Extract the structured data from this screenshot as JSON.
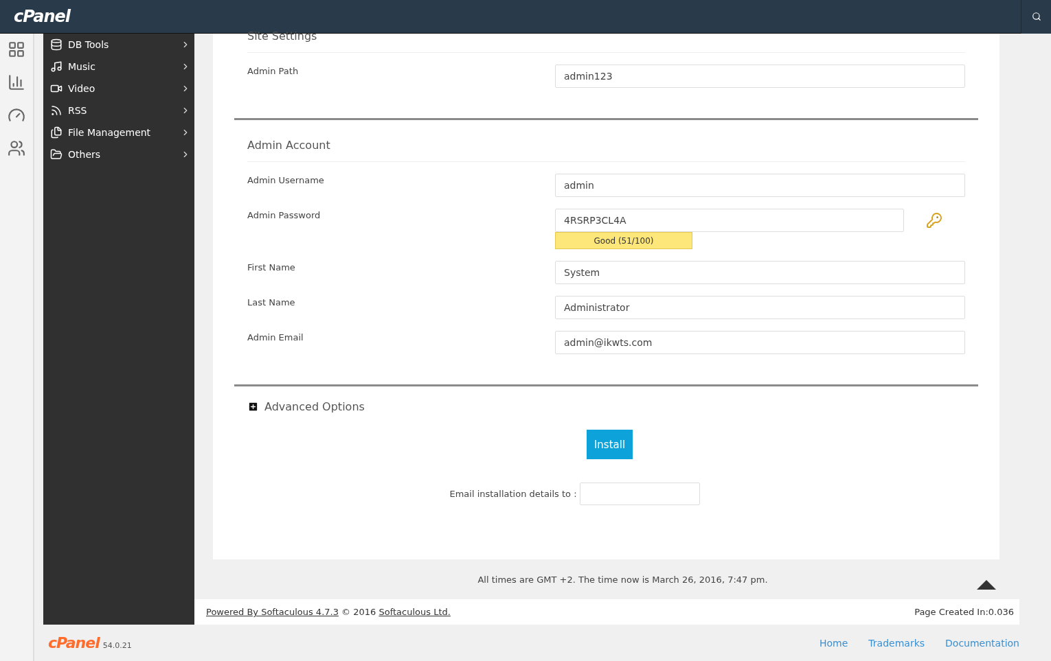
{
  "header": {
    "logo": "cPanel"
  },
  "rail": [
    {
      "kind": "grid"
    },
    {
      "kind": "stats"
    },
    {
      "kind": "gauge"
    },
    {
      "kind": "users"
    }
  ],
  "sidebar": {
    "items": [
      {
        "label": "DB Tools",
        "kind": "database"
      },
      {
        "label": "Music",
        "kind": "music"
      },
      {
        "label": "Video",
        "kind": "video"
      },
      {
        "label": "RSS",
        "kind": "rss"
      },
      {
        "label": "File Management",
        "kind": "files"
      },
      {
        "label": "Others",
        "kind": "folder"
      }
    ]
  },
  "sections": [
    {
      "title": "Site Settings",
      "fields": [
        {
          "label": "Admin Path",
          "value": "admin123",
          "kind": "text"
        }
      ]
    },
    {
      "title": "Admin Account",
      "fields": [
        {
          "label": "Admin Username",
          "value": "admin",
          "kind": "text"
        },
        {
          "label": "Admin Password",
          "value": "4RSRP3CL4A",
          "kind": "password",
          "strength": "Good (51/100)"
        },
        {
          "label": "First Name",
          "value": "System",
          "kind": "text"
        },
        {
          "label": "Last Name",
          "value": "Administrator",
          "kind": "text"
        },
        {
          "label": "Admin Email",
          "value": "admin@ikwts.com",
          "kind": "text"
        }
      ]
    }
  ],
  "advanced": {
    "label": "Advanced Options",
    "expanded": false
  },
  "install_button": "Install",
  "email_details": {
    "label": "Email installation details to :"
  },
  "time_note": "All times are GMT +2. The time now is March 26, 2016, 7:47 pm.",
  "footer": {
    "powered": "Powered By Softaculous 4.7.3",
    "copyright": "© 2016",
    "company": "Softaculous Ltd.",
    "page_created": "Page Created In:0.036"
  },
  "bottom": {
    "logo": "cPanel",
    "version": "54.0.21",
    "links": [
      "Home",
      "Trademarks",
      "Documentation"
    ]
  }
}
